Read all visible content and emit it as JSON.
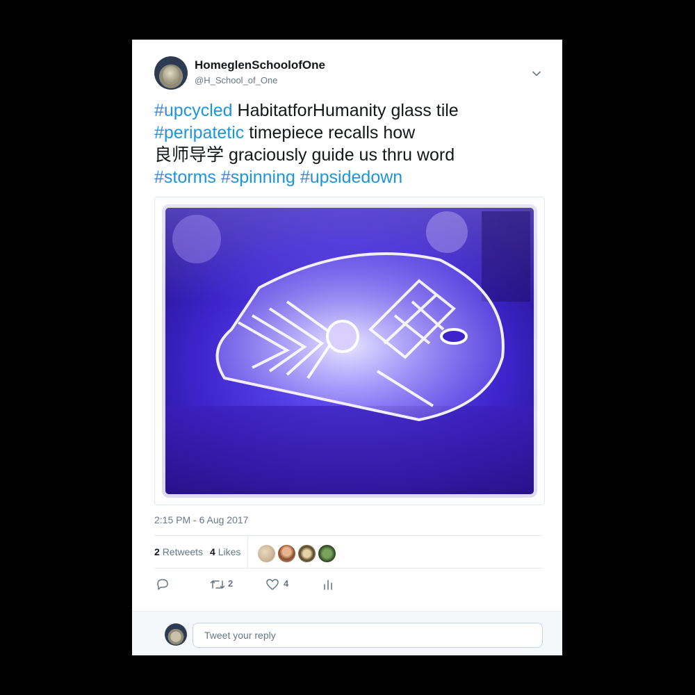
{
  "user": {
    "display_name": "HomeglenSchoolofOne",
    "handle": "@H_School_of_One"
  },
  "tweet": {
    "lines": [
      [
        {
          "t": "#upcycled",
          "tag": true
        },
        {
          "t": " HabitatforHumanity glass tile",
          "tag": false
        }
      ],
      [
        {
          "t": "#peripatetic",
          "tag": true
        },
        {
          "t": " timepiece recalls how",
          "tag": false
        }
      ],
      [
        {
          "t": "良师导学 graciously guide us thru word",
          "tag": false
        }
      ],
      [
        {
          "t": "#storms",
          "tag": true
        },
        {
          "t": " ",
          "tag": false
        },
        {
          "t": "#spinning",
          "tag": true
        },
        {
          "t": " ",
          "tag": false
        },
        {
          "t": "#upsidedown",
          "tag": true
        }
      ]
    ],
    "timestamp": "2:15 PM - 6 Aug 2017"
  },
  "stats": {
    "retweets_count": "2",
    "retweets_label": "Retweets",
    "likes_count": "4",
    "likes_label": "Likes"
  },
  "actions": {
    "retweet_count": "2",
    "like_count": "4"
  },
  "reply": {
    "placeholder": "Tweet your reply"
  },
  "colors": {
    "link": "#1b95e0",
    "text": "#14171a",
    "muted": "#657786"
  },
  "icons": [
    "chevron-down-icon",
    "reply-icon",
    "retweet-icon",
    "like-icon",
    "analytics-icon"
  ]
}
